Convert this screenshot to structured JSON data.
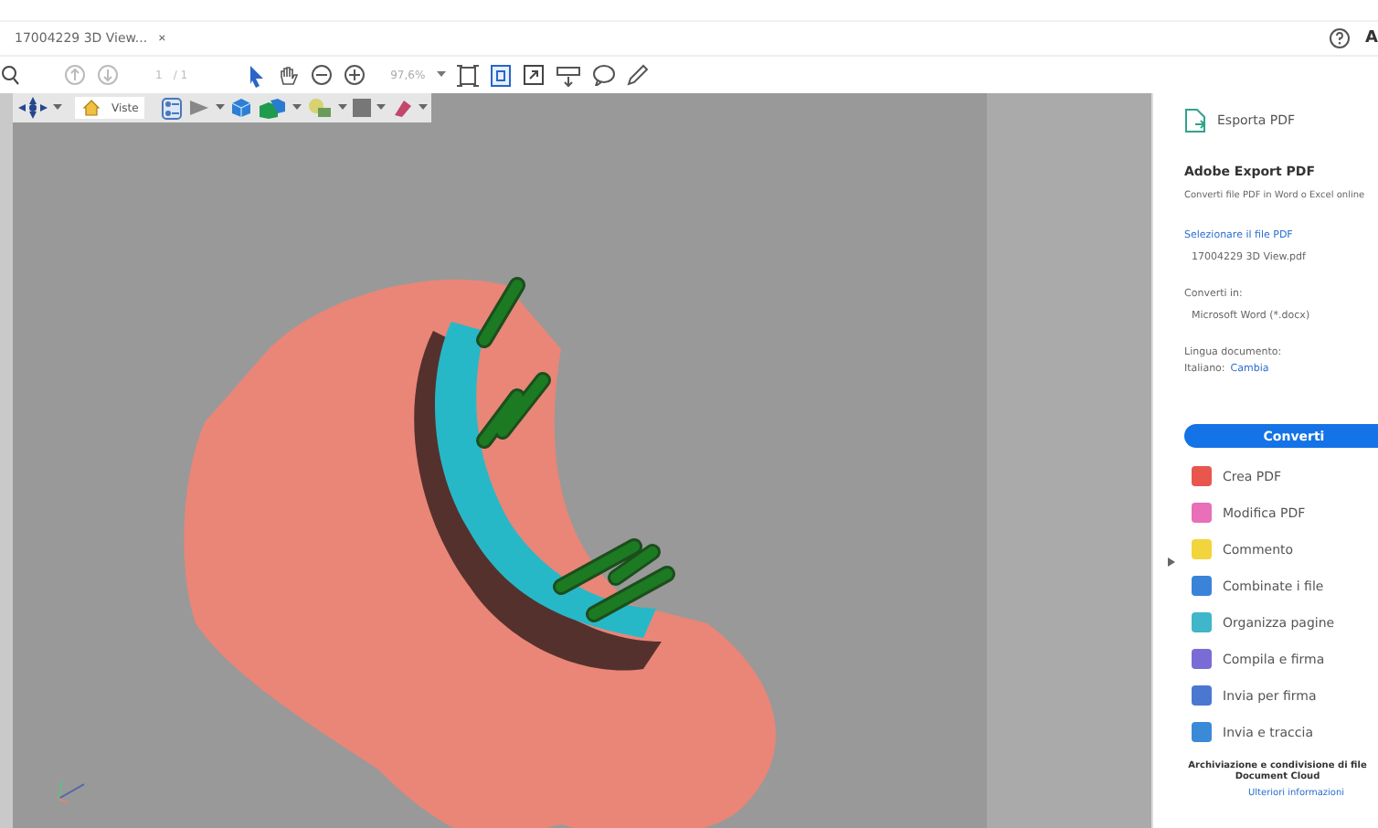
{
  "tab": {
    "title": "17004229 3D View...",
    "close": "×"
  },
  "header_right": {
    "account": "A"
  },
  "toolbar": {
    "page": "1",
    "page_total": "/ 1",
    "zoom": "97,6%"
  },
  "toolbar_3d": {
    "views_label": "Viste"
  },
  "panel": {
    "export_title": "Esporta PDF",
    "heading": "Adobe Export PDF",
    "description": "Converti file PDF in Word o Excel online",
    "select_link": "Selezionare il file PDF",
    "file_name": "17004229 3D View.pdf",
    "convert_to_label": "Converti in:",
    "convert_to_value": "Microsoft Word (*.docx)",
    "language_label": "Lingua documento:",
    "language_value": "Italiano:",
    "language_change": "Cambia",
    "convert_button": "Converti",
    "tools": [
      {
        "label": "Crea PDF",
        "color": "#e8564d"
      },
      {
        "label": "Modifica PDF",
        "color": "#e86fb8"
      },
      {
        "label": "Commento",
        "color": "#f2d43c"
      },
      {
        "label": "Combinate i file",
        "color": "#3a83d8"
      },
      {
        "label": "Organizza pagine",
        "color": "#3fb6c9"
      },
      {
        "label": "Compila e firma",
        "color": "#7a6cd6"
      },
      {
        "label": "Invia per firma",
        "color": "#4a78d0"
      },
      {
        "label": "Invia e traccia",
        "color": "#3a8ad8"
      }
    ],
    "footer_lines": [
      "Archiviazione e condivisione di file",
      "Document Cloud"
    ],
    "footer_link": "Ulteriori informazioni"
  }
}
